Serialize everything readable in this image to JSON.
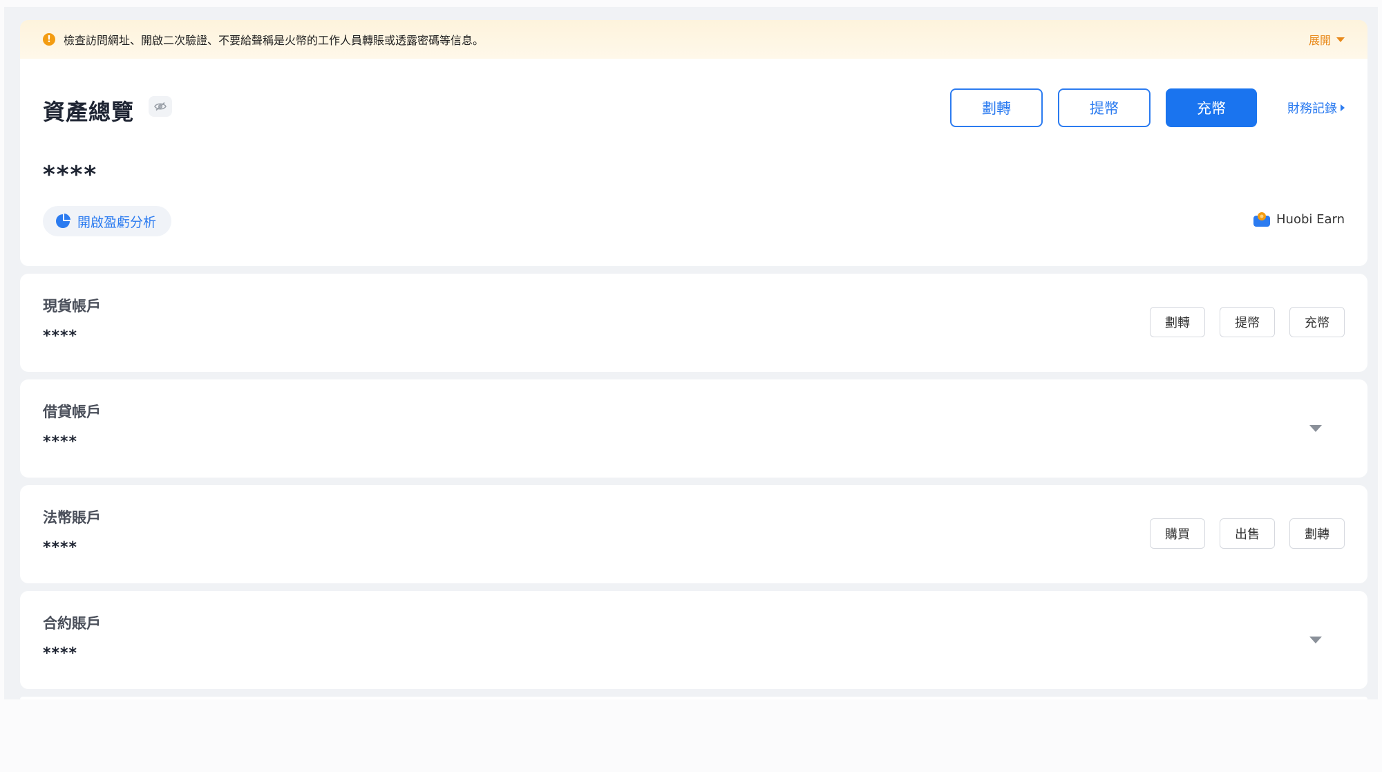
{
  "notice": {
    "text": "檢查訪問網址、開啟二次驗證、不要給聲稱是火幣的工作人員轉賬或透露密碼等信息。",
    "expand_label": "展開"
  },
  "overview": {
    "title": "資產總覽",
    "balance": "****",
    "actions": {
      "transfer": "劃轉",
      "withdraw": "提幣",
      "deposit": "充幣",
      "records": "財務記錄"
    },
    "pnl_label": "開啟盈虧分析",
    "earn_label": "Huobi Earn"
  },
  "accounts": [
    {
      "name": "現貨帳戶",
      "balance": "****",
      "actions": [
        "劃轉",
        "提幣",
        "充幣"
      ]
    },
    {
      "name": "借貸帳戶",
      "balance": "****"
    },
    {
      "name": "法幣賬戶",
      "balance": "****",
      "actions": [
        "購買",
        "出售",
        "劃轉"
      ]
    },
    {
      "name": "合約賬戶",
      "balance": "****"
    }
  ],
  "colors": {
    "accent": "#1a74ef",
    "warning": "#e8891a"
  }
}
